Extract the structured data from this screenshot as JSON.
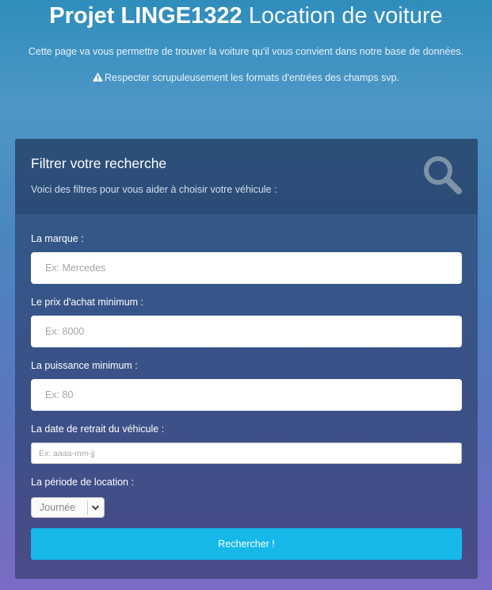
{
  "header": {
    "title_bold": "Projet LINGE1322",
    "title_light": "Location de voiture",
    "subtitle": "Cette page va vous permettre de trouver la voiture qu'il vous convient dans notre base de données.",
    "warning": "Respecter scrupuleusement les formats d'entrées des champs svp."
  },
  "panel": {
    "title": "Filtrer votre recherche",
    "description": "Voici des filtres pour vous aider à choisir votre véhicule :"
  },
  "form": {
    "brand": {
      "label": "La marque :",
      "placeholder": "Ex: Mercedes"
    },
    "min_price": {
      "label": "Le prix d'achat minimum :",
      "placeholder": "Ex: 8000"
    },
    "min_power": {
      "label": "La puissance minimum :",
      "placeholder": "Ex: 80"
    },
    "pickup_date": {
      "label": "La date de retrait du véhicule :",
      "placeholder": "Ex: aaaa-mm-jj"
    },
    "period": {
      "label": "La période de location :",
      "selected": "Journée"
    },
    "submit_label": "Rechercher !"
  },
  "icons": {
    "warning": "warning-icon",
    "search": "search-icon",
    "dropdown": "chevron-down-icon"
  },
  "colors": {
    "button": "#16b8e9",
    "background_top": "#2f8dbc",
    "background_bottom": "#7a6bc4"
  }
}
